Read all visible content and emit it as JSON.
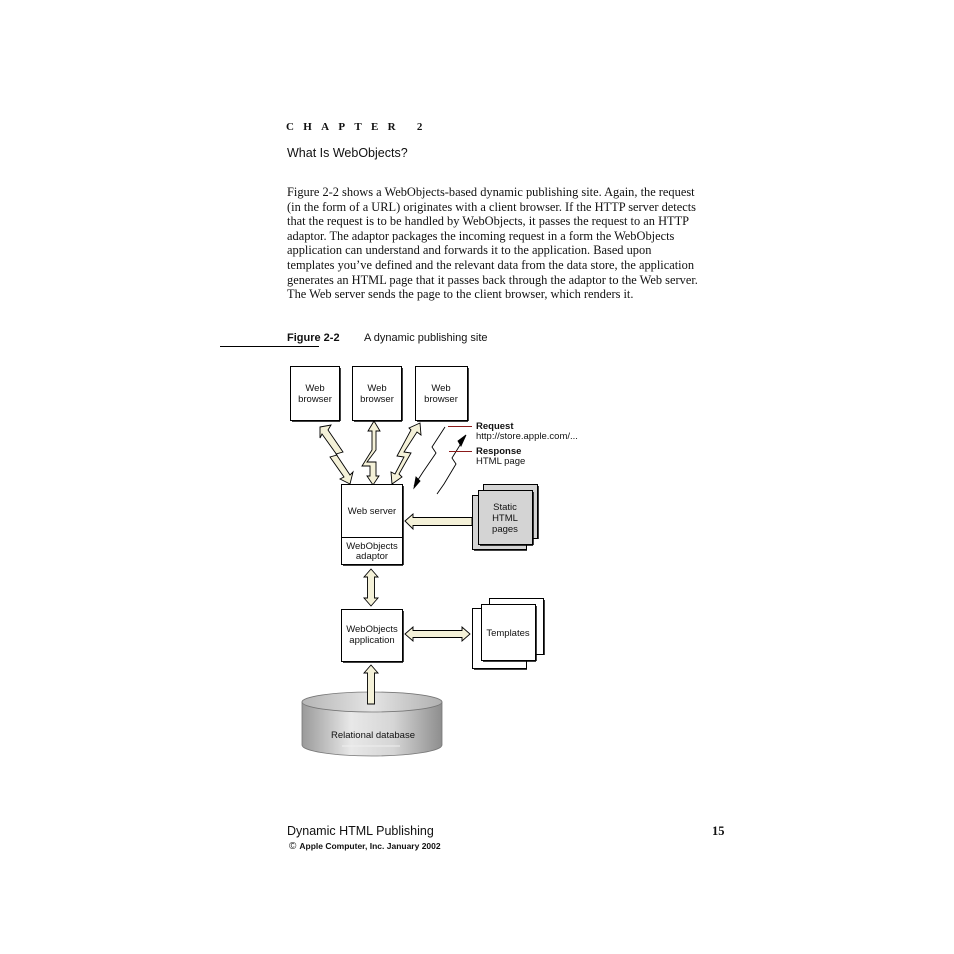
{
  "header": {
    "chapter_label": "CHAPTER 2",
    "section_title": "What Is WebObjects?"
  },
  "body": {
    "paragraph_lines": [
      "Figure 2-2 shows a WebObjects-based dynamic publishing site. Again, the request",
      "(in the form of a URL) originates with a client browser. If the HTTP server detects",
      "that the request is to be handled by WebObjects, it passes the request to an HTTP",
      "adaptor. The adaptor packages the incoming request in a form the WebObjects",
      "application can understand and forwards it to the application. Based upon",
      "templates you’ve defined and the relevant data from the data store, the application",
      "generates an HTML page that it passes back through the adaptor to the Web server.",
      "The Web server sends the page to the client browser, which renders it."
    ]
  },
  "figure": {
    "label": "Figure 2-2",
    "caption": "A dynamic publishing site",
    "browsers": [
      {
        "line1": "Web",
        "line2": "browser"
      },
      {
        "line1": "Web",
        "line2": "browser"
      },
      {
        "line1": "Web",
        "line2": "browser"
      }
    ],
    "legend": {
      "request_title": "Request",
      "request_detail": "http://store.apple.com/...",
      "response_title": "Response",
      "response_detail": "HTML page"
    },
    "web_server": "Web server",
    "adaptor_line1": "WebObjects",
    "adaptor_line2": "adaptor",
    "static_pages": {
      "line1": "Static",
      "line2": "HTML",
      "line3": "pages"
    },
    "application_line1": "WebObjects",
    "application_line2": "application",
    "templates": "Templates",
    "database": "Relational database",
    "colors": {
      "arrow_fill": "#f4f1d8",
      "legend_line": "#8b1a1a",
      "static_fill": "#d4d4d4",
      "db_light": "#e6e6e6",
      "db_dark": "#9a9a9a"
    }
  },
  "footer": {
    "title": "Dynamic HTML Publishing",
    "page_number": "15",
    "copyright_symbol": "©",
    "copyright": "Apple Computer, Inc. January 2002"
  }
}
